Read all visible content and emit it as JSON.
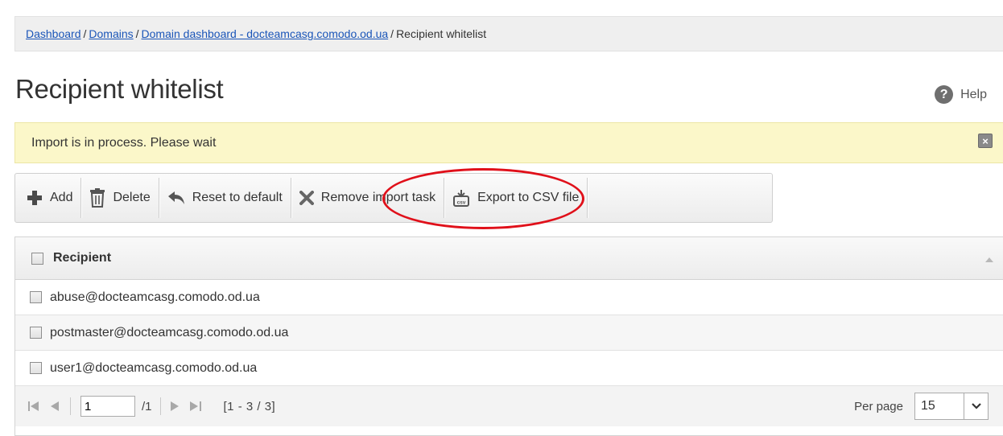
{
  "breadcrumb": {
    "items": [
      "Dashboard",
      "Domains",
      "Domain dashboard - docteamcasg.comodo.od.ua"
    ],
    "separator": "/",
    "current": "Recipient whitelist"
  },
  "page": {
    "title": "Recipient whitelist",
    "help_label": "Help",
    "help_icon": "?"
  },
  "notice": {
    "text": "Import is in process. Please wait",
    "close_icon": "×"
  },
  "toolbar": {
    "add_label": "Add",
    "delete_label": "Delete",
    "reset_label": "Reset to default",
    "remove_import_label": "Remove import task",
    "export_label": "Export to CSV file"
  },
  "table": {
    "header": "Recipient",
    "rows": [
      "abuse@docteamcasg.comodo.od.ua",
      "postmaster@docteamcasg.comodo.od.ua",
      "user1@docteamcasg.comodo.od.ua"
    ]
  },
  "pager": {
    "page": "1",
    "of": "/1",
    "range": "[1 - 3 / 3]",
    "per_page_label": "Per page",
    "per_page_value": "15"
  },
  "colors": {
    "link": "#1a55b8",
    "notice_bg": "#fbf7c9",
    "highlight": "#e0101a"
  }
}
